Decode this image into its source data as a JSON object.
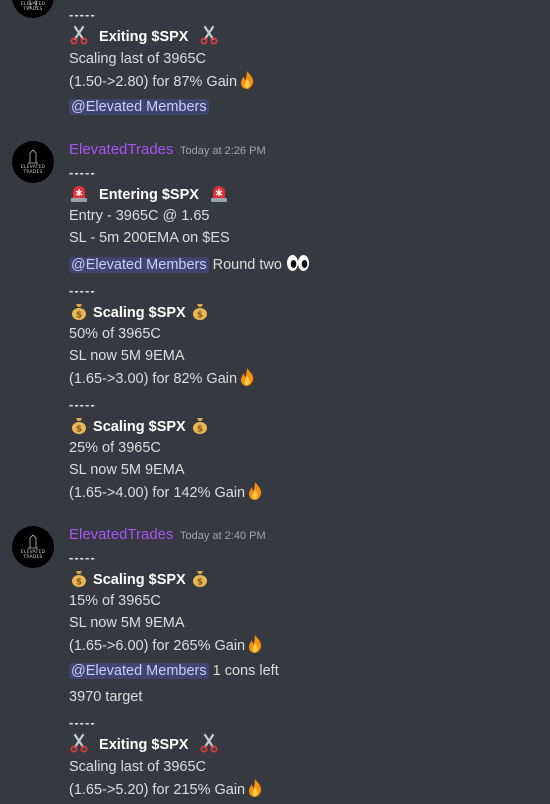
{
  "messages": {
    "msg0": {
      "dashes": "-----",
      "title": "Exiting $SPX",
      "line1": "Scaling last of 3965C",
      "line2": "(1.50->2.80) for 87% Gain",
      "mention": "@Elevated Members"
    },
    "msg1": {
      "username": "ElevatedTrades",
      "timestamp": "Today at 2:26 PM",
      "avatar_text": "ELEVATED TRADES",
      "dashes": "-----",
      "title": "Entering $SPX",
      "line1": "Entry - 3965C @ 1.65",
      "line2": "SL - 5m 200EMA on $ES",
      "mention": "@Elevated Members",
      "after_mention": "Round two"
    },
    "msg2": {
      "dashes": "-----",
      "title": "Scaling $SPX",
      "line1": "50% of 3965C",
      "line2": "SL now 5M 9EMA",
      "line3": "(1.65->3.00) for 82% Gain"
    },
    "msg3": {
      "dashes": "-----",
      "title": "Scaling $SPX",
      "line1": "25% of 3965C",
      "line2": "SL now 5M 9EMA",
      "line3": "(1.65->4.00) for 142% Gain"
    },
    "msg4": {
      "username": "ElevatedTrades",
      "timestamp": "Today at 2:40 PM",
      "avatar_text": "ELEVATED TRADES",
      "dashes": "-----",
      "title": "Scaling $SPX",
      "line1": "15% of 3965C",
      "line2": "SL now 5M 9EMA",
      "line3": "(1.65->6.00) for 265% Gain",
      "mention": "@Elevated Members",
      "after_mention": "1 cons left",
      "extra": "3970 target"
    },
    "msg5": {
      "dashes": "-----",
      "title": "Exiting $SPX",
      "line1": "Scaling last of 3965C",
      "line2": "(1.65->5.20) for 215% Gain"
    }
  },
  "icons": {
    "scissors": "scissors-icon",
    "siren": "siren-icon",
    "moneybag": "money-bag-icon",
    "fire": "fire-icon",
    "eyes": "eyes-icon"
  },
  "colors": {
    "background": "#36393f",
    "username": "#a855f7",
    "mention_bg": "#3e4475",
    "text": "#dcddde"
  }
}
